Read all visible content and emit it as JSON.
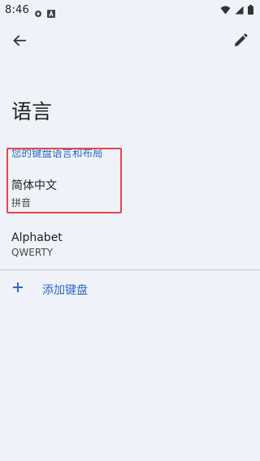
{
  "status_bar": {
    "time": "8:46"
  },
  "header": {
    "title": "语言"
  },
  "section": {
    "label": "您的键盘语言和布局"
  },
  "languages": [
    {
      "name": "简体中文",
      "layout": "拼音"
    },
    {
      "name": "Alphabet",
      "layout": "QWERTY"
    }
  ],
  "add_keyboard": {
    "label": "添加键盘"
  },
  "colors": {
    "accent": "#2d6ac4",
    "background": "#eff2f8",
    "highlight": "#e4474b"
  },
  "icons": [
    "gear-icon",
    "a-box-icon",
    "wifi-icon",
    "signal-icon",
    "battery-icon",
    "back-arrow-icon",
    "edit-pencil-icon",
    "plus-icon"
  ]
}
